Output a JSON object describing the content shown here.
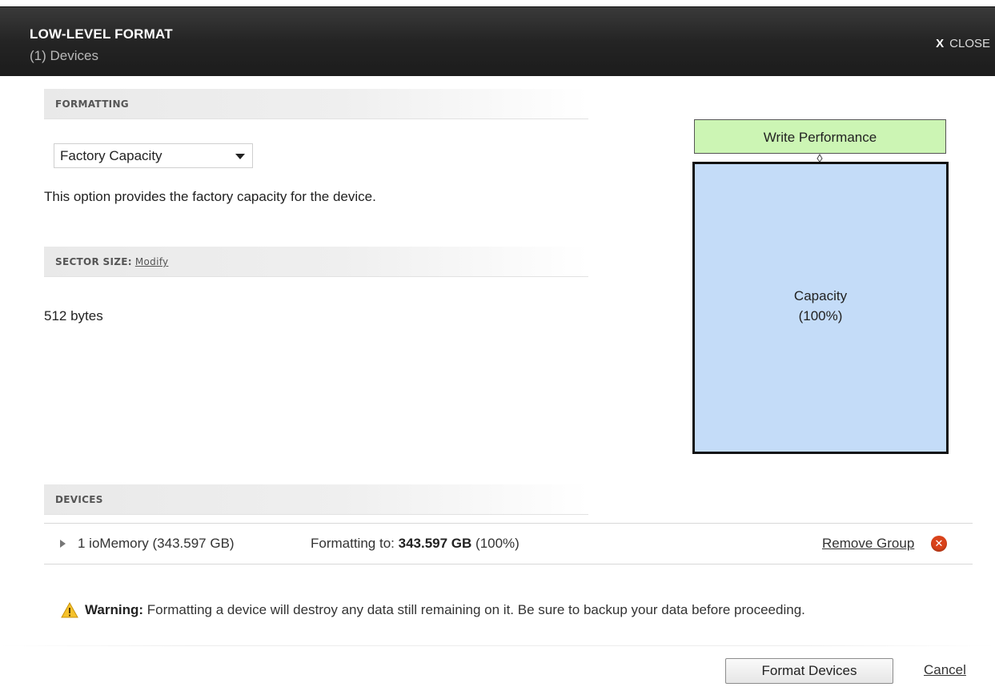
{
  "window": {
    "title": "LOW-LEVEL FORMAT",
    "subtitle": "(1) Devices",
    "close_x": "X",
    "close_label": "CLOSE"
  },
  "formatting": {
    "section_title": "FORMATTING",
    "selected_option": "Factory Capacity",
    "description": "This option provides the factory capacity for the device."
  },
  "sector_size": {
    "section_title": "SECTOR SIZE:",
    "modify_link": "Modify",
    "value": "512 bytes"
  },
  "diagram": {
    "write_performance_label": "Write Performance",
    "capacity_label": "Capacity",
    "capacity_percent": "(100%)",
    "colors": {
      "write_performance_fill": "#ccf5b4",
      "capacity_fill": "#c4dcf8"
    }
  },
  "devices": {
    "section_title": "DEVICES",
    "rows": [
      {
        "name": "1 ioMemory (343.597 GB)",
        "formatting_label": "Formatting to:",
        "formatting_size": "343.597 GB",
        "formatting_percent": "(100%)",
        "remove_label": "Remove Group",
        "remove_icon": "x-circle-icon"
      }
    ]
  },
  "warning": {
    "icon": "warning-triangle-icon",
    "label": "Warning:",
    "text": "Formatting a device will destroy any data still remaining on it. Be sure to backup your data before proceeding."
  },
  "footer": {
    "format_button": "Format Devices",
    "cancel_link": "Cancel"
  }
}
